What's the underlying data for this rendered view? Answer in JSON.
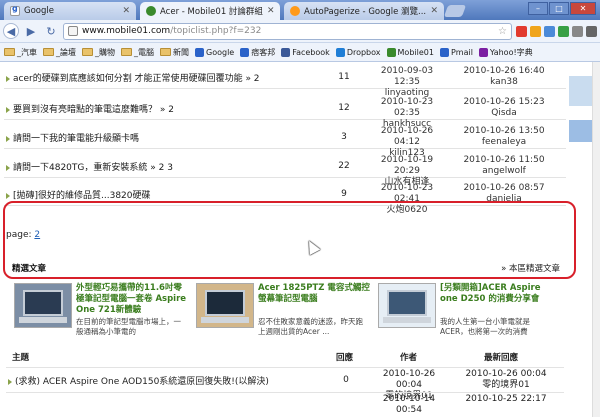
{
  "tabs": [
    {
      "label": "Google",
      "favicon": "google-favicon",
      "active": false
    },
    {
      "label": "Acer - Mobile01 討論群組",
      "favicon": "mobile01-favicon",
      "active": true
    },
    {
      "label": "AutoPagerize - Google 瀏覽...",
      "favicon": "autopagerize-favicon",
      "active": false
    }
  ],
  "window": {
    "minimize": "–",
    "maximize": "□",
    "close": "✕"
  },
  "omnibox": {
    "host": "www.mobile01.com",
    "path": "/topiclist.php?f=232"
  },
  "bookmarks": [
    {
      "label": "_汽車",
      "type": "folder"
    },
    {
      "label": "_論壇",
      "type": "folder"
    },
    {
      "label": "_購物",
      "type": "folder"
    },
    {
      "label": "_電腦",
      "type": "folder"
    },
    {
      "label": "新聞",
      "type": "folder"
    },
    {
      "label": "Google",
      "type": "site",
      "color": "#2a62c9"
    },
    {
      "label": "痞客邦",
      "type": "site",
      "color": "#2a62c9"
    },
    {
      "label": "Facebook",
      "type": "site",
      "color": "#3b5998"
    },
    {
      "label": "Dropbox",
      "type": "site",
      "color": "#1f7ed6"
    },
    {
      "label": "Mobile01",
      "type": "site",
      "color": "#3a8a2c"
    },
    {
      "label": "Pmail",
      "type": "site",
      "color": "#2a62c9"
    },
    {
      "label": "Yahoo!字典",
      "type": "site",
      "color": "#7b1fa2"
    }
  ],
  "topics": [
    {
      "title": "acer的硬碟到底應該如何分割 才能正常使用硬碟回覆功能",
      "pages": " » 2",
      "count": "11",
      "post_date": "2010-09-03 12:35",
      "post_user": "linyaoting",
      "last_date": "2010-10-26 16:40",
      "last_user": "kan38"
    },
    {
      "title": "要買到沒有亮暗點的筆電這麼難嗎？",
      "pages": " » 2",
      "count": "12",
      "post_date": "2010-10-23 02:35",
      "post_user": "hankhsucc",
      "last_date": "2010-10-26 15:23",
      "last_user": "Qisda"
    },
    {
      "title": "請問一下我的筆電能升級顯卡嗎",
      "pages": "",
      "count": "3",
      "post_date": "2010-10-26 04:12",
      "post_user": "kilin123",
      "last_date": "2010-10-26 13:50",
      "last_user": "feenaleya"
    },
    {
      "title": "請問一下4820TG，重新安裝系統",
      "pages": " » 2 3",
      "count": "22",
      "post_date": "2010-10-19 20:29",
      "post_user": "山水有相逢",
      "last_date": "2010-10-26 11:50",
      "last_user": "angelwolf"
    },
    {
      "title": "[拋磚]很好的維修品質...3820硬碟",
      "pages": "",
      "count": "9",
      "post_date": "2010-10-23 02:41",
      "post_user": "火炮0620",
      "last_date": "2010-10-26 08:57",
      "last_user": "danielja"
    }
  ],
  "pager": {
    "label": "page:",
    "link": "2"
  },
  "featured": {
    "label": "精選文章",
    "more": "» 本區精選文章",
    "cards": [
      {
        "title": "外型輕巧易攜帶的11.6吋零極筆記型電腦一套卷 Aspire One 721新體驗",
        "desc": "在目前的筆記型電腦市場上，一般通稱為小筆電的"
      },
      {
        "title": "Acer 1825PTZ 電容式觸控螢幕筆記型電腦",
        "desc": "忍不住敗家意義的迷惑，昨天跑上週剛出貨的Acer ..."
      },
      {
        "title": "[另類開箱]ACER Aspire one D250 的消費分享會",
        "desc": "我的人生第一台小筆電就是ACER，也將第一次的消費"
      }
    ]
  },
  "list_header": {
    "subject": "主題",
    "replies": "回應",
    "author": "作者",
    "last_reply": "最新回應"
  },
  "list_rows": [
    {
      "title": "(求救) ACER Aspire One AOD150系統還原回復失敗!(以解決)",
      "count": "0",
      "post_date": "2010-10-26 00:04",
      "post_user": "零的境界01",
      "last_date": "2010-10-26 00:04",
      "last_user": "零的境界01"
    },
    {
      "title": "",
      "count": "",
      "post_date": "2010-10-14 00:54",
      "post_user": "",
      "last_date": "2010-10-25 22:17",
      "last_user": ""
    }
  ]
}
